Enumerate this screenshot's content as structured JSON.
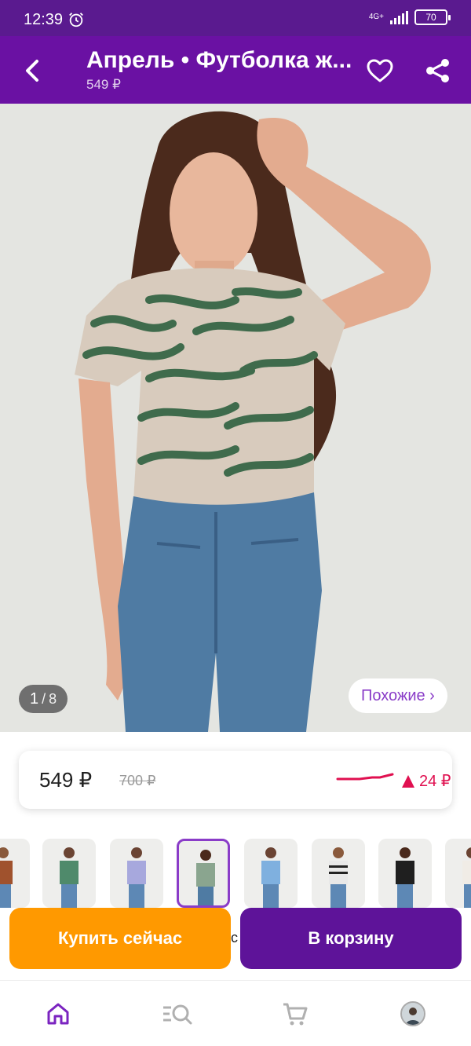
{
  "status_bar": {
    "time": "12:39",
    "network": "4G+",
    "battery": "70"
  },
  "header": {
    "title": "Апрель • Футболка ж...",
    "price": "549 ₽"
  },
  "gallery": {
    "current": "1",
    "separator": "/",
    "total": "8",
    "similar_label": "Похожие ›"
  },
  "price_block": {
    "price": "549 ₽",
    "old_price": "700 ₽",
    "trend": "24 ₽"
  },
  "cut_text": "ис",
  "buttons": {
    "buy_now": "Купить сейчас",
    "add_to_cart": "В корзину"
  },
  "colors": {
    "brand": "#6a11a3",
    "accent_orange": "#ff9900",
    "cart_purple": "#5e1399",
    "trend_red": "#e01050",
    "link_purple": "#8a3cc8"
  },
  "nav": {
    "items": [
      "home-icon",
      "catalog-search-icon",
      "cart-icon",
      "profile-avatar"
    ]
  }
}
